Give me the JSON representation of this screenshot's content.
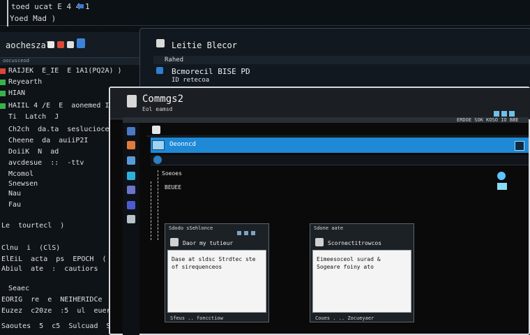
{
  "terminal": {
    "title": "toed ucat E 4 4 1",
    "subtitle": "Yoed Mad )"
  },
  "left_panel": {
    "header": "aocheszal",
    "strip_label": "oocusceod",
    "rows": [
      "RAIJEK  E_IE  E 1A1(PQ2A) )",
      "Reyearth",
      "HIAN",
      "HAIIL 4 /E  E  aonemed I ( (C",
      "Ti  Latch  J",
      "Ch2ch  da.ta  seslucioce",
      "Cheene  da  auiiP2I",
      "DoiiK  N  ad",
      "avcdesue  ::  -ttv",
      "Mcomol",
      "Snewsen",
      "Nau",
      "Fau",
      "Le  tourtecl  )",
      "Clnu  i  (ClS)",
      "ElEiL  acta  ps  EPOCH  ( 3S)",
      "Abiul  ate  :  cautiors",
      "Seaec",
      "EORIG  re  e  NEIHERIDCe",
      "Euzez  c20ze  :5  ul  euerige  S",
      "Saoutes  5  c5  Sulcuad  S"
    ]
  },
  "back_window": {
    "title": "Leitie  Blecor",
    "bar_text": "Rahed",
    "row1": "Bcmorecil  BISE  PD",
    "row2": "ID  retecoa"
  },
  "main_window": {
    "title": "Commgs2",
    "subtitle": "Eol  eamsd",
    "strip_text": "ERDOE  SOK  KOSO  IO  BBE",
    "selected_row": "Oeonncd",
    "tree_label1": "Soeoes",
    "tree_label2": "BEUEE"
  },
  "dialogs": [
    {
      "title": "Sdodo  sSehlonce",
      "head": "Daor  my  tutieur",
      "body": "Dase  at  sldsc  Strdtec  ste  of  sirequenceos",
      "foot": "Sfeus  ..  foncctiow"
    },
    {
      "title": "Sdone  aate",
      "head": "Scornectitrowcos",
      "body": "Eimeesoceol  surad  &  Sogeare  foiny  ato",
      "foot": "Coues  . ..  Zocueyaer"
    }
  ],
  "colors": {
    "accent_blue": "#1e89d6",
    "window_border": "#d7dbe0"
  }
}
